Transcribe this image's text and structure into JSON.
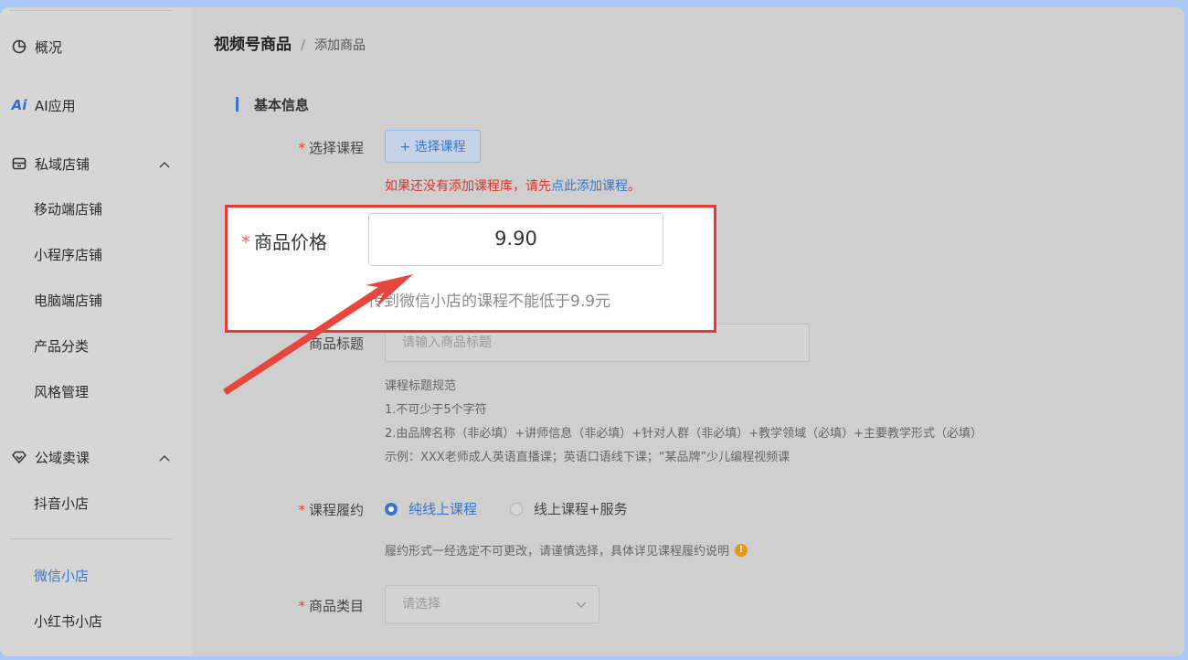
{
  "sidebar": {
    "items": [
      {
        "label": "概况"
      },
      {
        "label": "AI应用",
        "icon_text": "Ai"
      },
      {
        "label": "私域店铺"
      },
      {
        "label": "公域卖课"
      }
    ],
    "private_sub": [
      "移动端店铺",
      "小程序店铺",
      "电脑端店铺",
      "产品分类",
      "风格管理"
    ],
    "public_sub": [
      "抖音小店",
      "微信小店",
      "小红书小店"
    ]
  },
  "breadcrumb": {
    "parent": "视频号商品",
    "separator": "/",
    "current": "添加商品"
  },
  "section_title": "基本信息",
  "form": {
    "course": {
      "label": "选择课程",
      "button": "+ 选择课程",
      "hint_prefix": "如果还没有添加课程库，请先",
      "hint_link": "点此添加课程",
      "hint_suffix": "。"
    },
    "price": {
      "label": "商品价格",
      "value": "9.90",
      "hint": "传到微信小店的课程不能低于9.9元"
    },
    "title": {
      "label": "商品标题",
      "placeholder": "请输入商品标题",
      "rules": [
        "课程标题规范",
        "1.不可少于5个字符",
        "2.由品牌名称（非必填）+讲师信息（非必填）+针对人群（非必填）+教学领域（必填）+主要教学形式（必填）",
        "示例：XXX老师成人英语直播课；英语口语线下课；“某品牌”少儿编程视频课"
      ]
    },
    "fulfilment": {
      "label": "课程履约",
      "options": [
        "纯线上课程",
        "线上课程+服务"
      ],
      "selected": "纯线上课程",
      "hint": "履约形式一经选定不可更改，请谨慎选择，具体详见课程履约说明",
      "warn_icon": "!"
    },
    "category": {
      "label": "商品类目",
      "placeholder": "请选择"
    }
  },
  "required_mark": "*",
  "colors": {
    "accent": "#3a76c8",
    "highlight_border": "#e43b33",
    "arrow": "#e8453c",
    "error_text": "#d9362b"
  }
}
